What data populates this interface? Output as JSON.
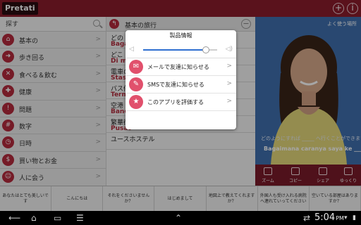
{
  "app": {
    "logo": "Pretati"
  },
  "topbar": {
    "add_icon": "+",
    "info_icon": "i"
  },
  "sidebar": {
    "search_label": "探す",
    "categories": [
      {
        "label": "基本の",
        "icon": "home"
      },
      {
        "label": "歩き回る",
        "icon": "walk"
      },
      {
        "label": "食べる＆飲む",
        "icon": "fork-knife"
      },
      {
        "label": "健康",
        "icon": "health"
      },
      {
        "label": "問題",
        "icon": "problem"
      },
      {
        "label": "数字",
        "icon": "numbers"
      },
      {
        "label": "日時",
        "icon": "clock"
      },
      {
        "label": "買い物とお金",
        "icon": "shopping"
      },
      {
        "label": "人に会う",
        "icon": "people"
      }
    ]
  },
  "phrases": {
    "header_title": "基本の旅行",
    "items": [
      {
        "jp": "どの",
        "romaji": "Bagai"
      },
      {
        "jp": "どこ",
        "romaji": "Di ma"
      },
      {
        "jp": "電車の",
        "romaji": "Stasiu"
      },
      {
        "jp": "バス停",
        "romaji": "Termi"
      },
      {
        "jp": "空港",
        "romaji": "Banda"
      },
      {
        "jp": "繁華街",
        "romaji": "Pusat"
      },
      {
        "jp": "ユースホステル",
        "romaji": ""
      }
    ]
  },
  "photo_panel": {
    "label": "よく使う場所",
    "sentence_jp": "どのようにすれば _____ へ行くことができますか？",
    "sentence_romaji": "Bagaimana caranya saya ke _____ ?",
    "actions": [
      {
        "label": "ズーム",
        "icon": "zoom"
      },
      {
        "label": "コピー",
        "icon": "copy"
      },
      {
        "label": "シェア",
        "icon": "share"
      },
      {
        "label": "ゆっくり",
        "icon": "slow"
      }
    ]
  },
  "quickbar": [
    "あなたはとても美しいです",
    "こんにちは",
    "それをくださいませんか？",
    "はじめまして",
    "地図上で教えてくれますか？",
    "外国人も受け入れる病院へ連れていってください",
    "空いている部屋はありますか？"
  ],
  "navbar": {
    "time": "5:04",
    "period": "PM"
  },
  "dialog": {
    "title": "製品情報",
    "volume_level": 0.85,
    "items": [
      {
        "label": "メールで友達に知らせる",
        "icon": "mail"
      },
      {
        "label": "SMSで友達に知らせる",
        "icon": "sms"
      },
      {
        "label": "このアプリを評価する",
        "icon": "star"
      }
    ]
  }
}
